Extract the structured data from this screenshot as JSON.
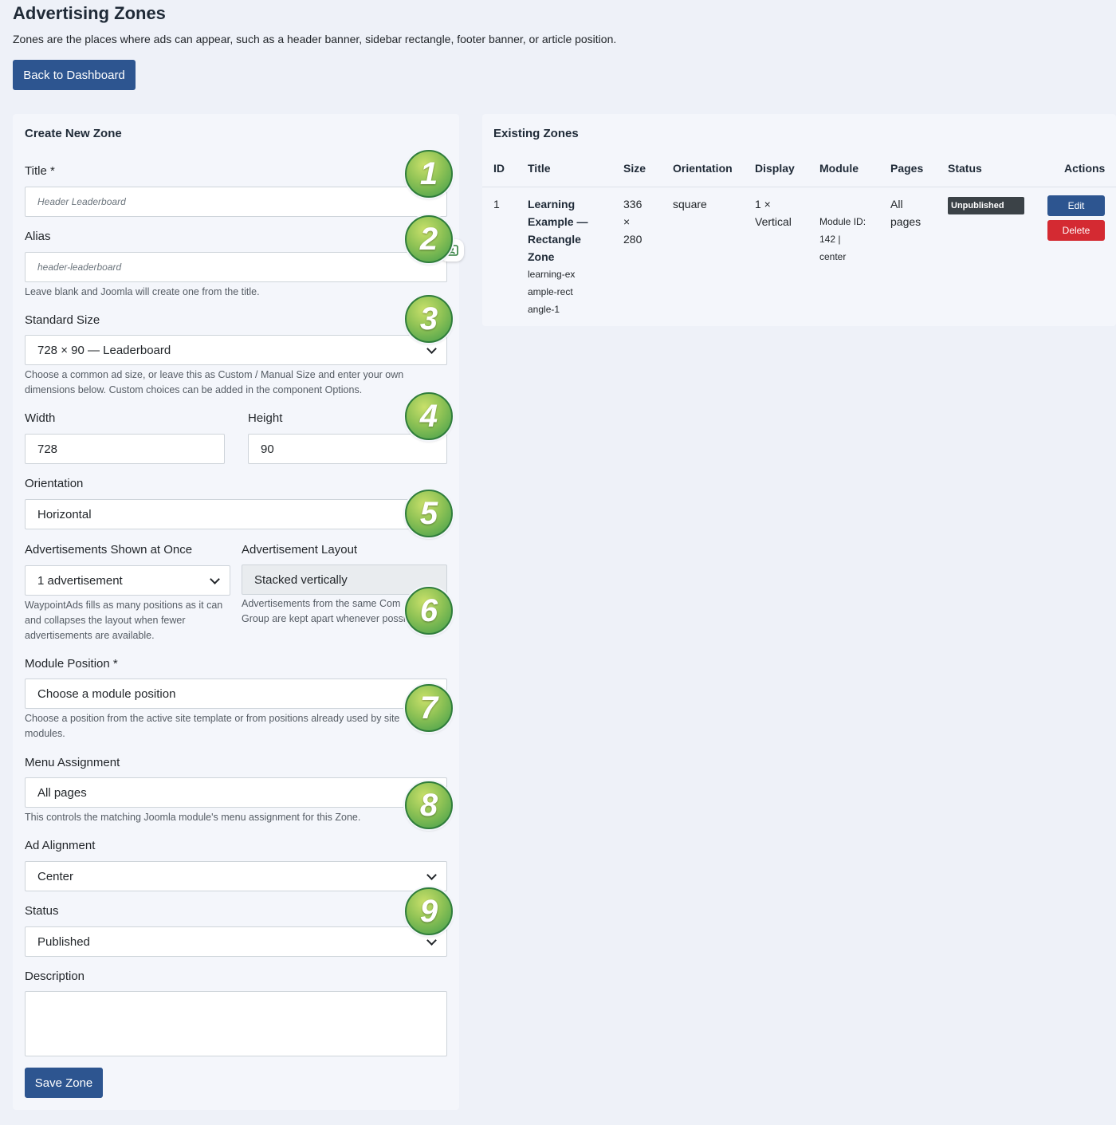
{
  "header": {
    "title": "Advertising Zones",
    "intro": "Zones are the places where ads can appear, such as a header banner, sidebar rectangle, footer banner, or article position.",
    "back_label": "Back to Dashboard"
  },
  "form": {
    "heading": "Create New Zone",
    "title_label": "Title *",
    "title_placeholder": "Header Leaderboard",
    "alias_label": "Alias",
    "alias_placeholder": "header-leaderboard",
    "alias_hint": "Leave blank and Joomla will create one from the title.",
    "size_label": "Standard Size",
    "size_value": "728 × 90 — Leaderboard",
    "size_hint": "Choose a common ad size, or leave this as Custom / Manual Size and enter your own dimensions below. Custom choices can be added in the component Options.",
    "width_label": "Width",
    "width_value": "728",
    "height_label": "Height",
    "height_value": "90",
    "orientation_label": "Orientation",
    "orientation_value": "Horizontal",
    "shown_label": "Advertisements Shown at Once",
    "shown_value": "1 advertisement",
    "shown_hint": "WaypointAds fills as many positions as it can and collapses the layout when fewer advertisements are available.",
    "layout_label": "Advertisement Layout",
    "layout_value": "Stacked vertically",
    "layout_hint": "Advertisements from the same Com Group are kept apart whenever possi",
    "position_label": "Module Position *",
    "position_value": "Choose a module position",
    "position_hint": "Choose a position from the active site template or from positions already used by site modules.",
    "menu_label": "Menu Assignment",
    "menu_value": "All pages",
    "menu_hint": "This controls the matching Joomla module's menu assignment for this Zone.",
    "align_label": "Ad Alignment",
    "align_value": "Center",
    "status_label": "Status",
    "status_value": "Published",
    "description_label": "Description",
    "save_label": "Save Zone"
  },
  "markers": [
    "1",
    "2",
    "3",
    "4",
    "5",
    "6",
    "7",
    "8",
    "9"
  ],
  "zones": {
    "heading": "Existing Zones",
    "columns": [
      "ID",
      "Title",
      "Size",
      "Orientation",
      "Display",
      "Module",
      "Pages",
      "Status",
      "Actions"
    ],
    "rows": [
      {
        "id": "1",
        "title": "Learning Example — Rectangle Zone",
        "alias": "learning-example-rectangle-1",
        "size": "336 × 280",
        "orientation": "square",
        "display": "1 × Vertical",
        "module": "Module ID: 142 | center",
        "pages": "All pages",
        "status": "Unpublished",
        "edit_label": "Edit",
        "delete_label": "Delete"
      }
    ]
  },
  "colors": {
    "primary": "#2d5590",
    "danger": "#d42a32",
    "badge": "#3b4247",
    "marker": "#8ec255"
  }
}
